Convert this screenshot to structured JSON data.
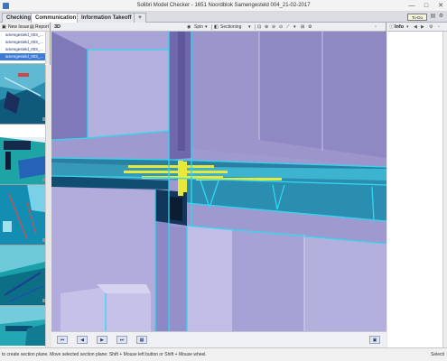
{
  "window": {
    "title": "Solibri Model Checker - 1651 Noordblok Samengesteld 004_21-02-2017",
    "controls": [
      "—",
      "□",
      "✕"
    ]
  },
  "tabs": [
    {
      "label": "Checking"
    },
    {
      "label": "Communication"
    },
    {
      "label": "Information Takeoff"
    },
    {
      "label": "+"
    }
  ],
  "tabbar_right": {
    "todo": "To-Do (0/0)"
  },
  "left_panel": {
    "toolbar": {
      "new_issue": "New Issue",
      "report": "Report"
    },
    "issues": [
      "amengesteld_003_...",
      "amengesteld_003_...",
      "amengesteld_003_...",
      "amengesteld_003_..."
    ]
  },
  "view3d": {
    "label": "3D",
    "toolbar": {
      "spin": "Spin",
      "sectioning": "Sectioning"
    },
    "nav_buttons": [
      "⏮",
      "◀",
      "▶",
      "⏭",
      "▦"
    ]
  },
  "info_panel": {
    "label": "Info"
  },
  "status": {
    "message": "to create section plane. Move selected section plane: Shift + Mouse left button or Shift + Mouse wheel.",
    "right": "Selecti"
  },
  "colors": {
    "section_outline": "#2fd7f0",
    "wall_purple": "#8d86c6",
    "highlight_yellow": "#e8e83a"
  }
}
